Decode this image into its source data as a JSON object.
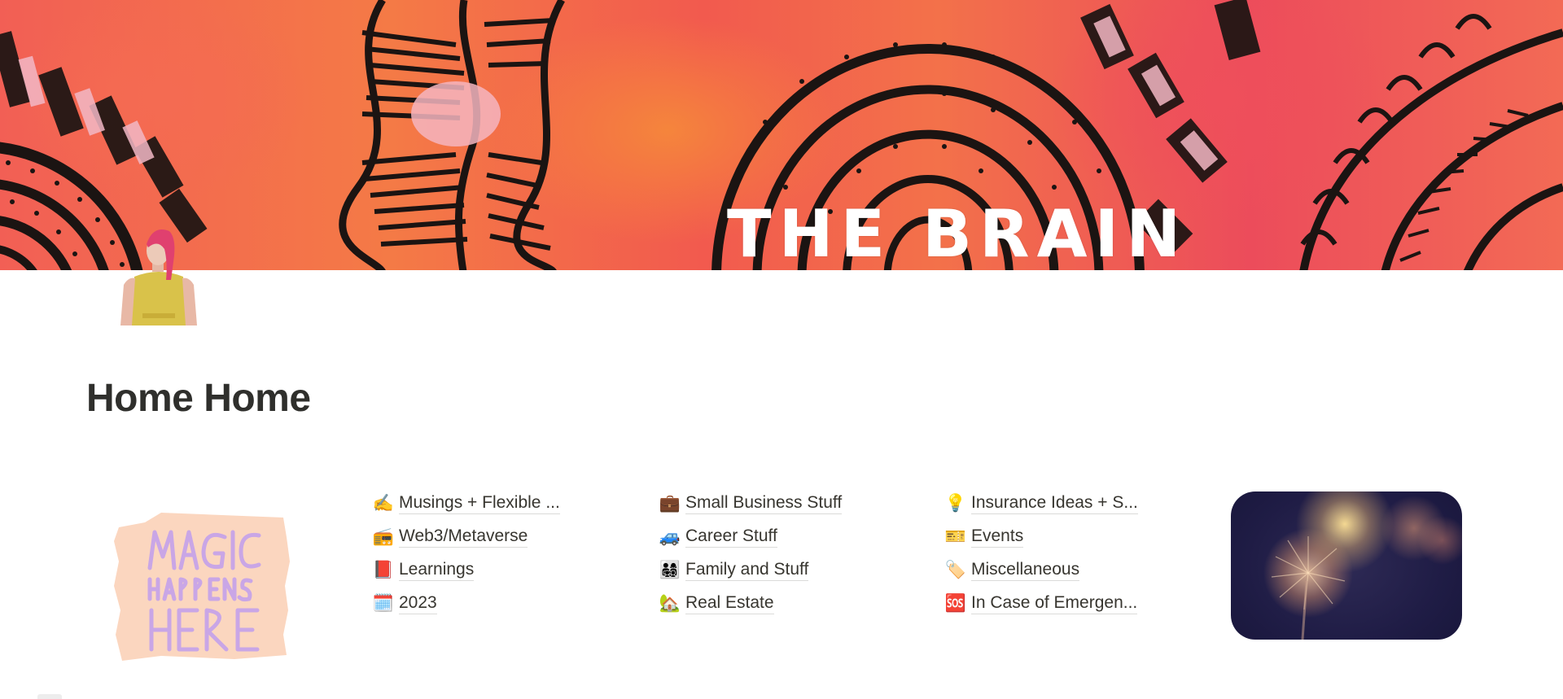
{
  "cover": {
    "title": "THE BRAIN",
    "palette": [
      "#f25f55",
      "#f47a46",
      "#ec4c5b",
      "#1a1a1a"
    ]
  },
  "page": {
    "icon": "avatar-woman-pink-hair-icon",
    "title": "Home Home"
  },
  "images": {
    "left": {
      "alt": "Magic Happens Here illustration",
      "line1": "MAGIC",
      "line2": "HAPPENS",
      "line3": "HERE"
    },
    "right": {
      "alt": "Dandelion at sunset photo"
    }
  },
  "columns": [
    {
      "items": [
        {
          "icon": "writing-hand-icon",
          "glyph": "✍️",
          "label": "Musings + Flexible ..."
        },
        {
          "icon": "radio-icon",
          "glyph": "📻",
          "label": "Web3/Metaverse"
        },
        {
          "icon": "red-book-icon",
          "glyph": "📕",
          "label": "Learnings"
        },
        {
          "icon": "spiral-calendar-icon",
          "glyph": "🗓️",
          "label": "2023"
        }
      ]
    },
    {
      "items": [
        {
          "icon": "briefcase-icon",
          "glyph": "💼",
          "label": "Small Business Stuff"
        },
        {
          "icon": "trailer-icon",
          "glyph": "🚙",
          "label": "Career Stuff"
        },
        {
          "icon": "family-icon",
          "glyph": "👨‍👩‍👧‍👦",
          "label": "Family and Stuff"
        },
        {
          "icon": "house-with-garden-icon",
          "glyph": "🏡",
          "label": "Real Estate"
        }
      ]
    },
    {
      "items": [
        {
          "icon": "light-bulb-icon",
          "glyph": "💡",
          "label": "Insurance Ideas + S..."
        },
        {
          "icon": "ticket-icon",
          "glyph": "🎫",
          "label": "Events"
        },
        {
          "icon": "label-tag-icon",
          "glyph": "🏷️",
          "label": "Miscellaneous"
        },
        {
          "icon": "sos-icon",
          "glyph": "🆘",
          "label": "In Case of Emergen..."
        }
      ]
    }
  ]
}
